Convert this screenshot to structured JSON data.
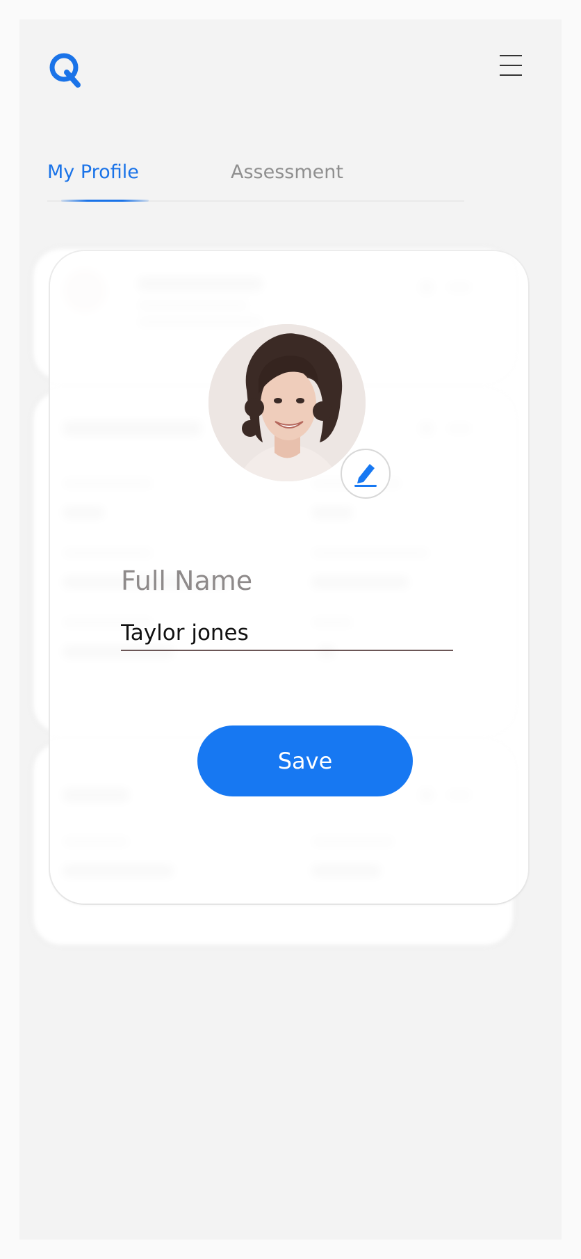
{
  "app": {
    "logo_letter": "Q",
    "brand_color": "#1a73e8"
  },
  "header": {
    "menu_icon": "hamburger-menu-icon"
  },
  "tabs": [
    {
      "label": "My Profile",
      "active": true
    },
    {
      "label": "Assessment",
      "active": false
    }
  ],
  "modal": {
    "field_label": "Full Name",
    "field_value": "Taylor jones",
    "save_label": "Save",
    "edit_icon": "pencil-icon",
    "avatar": "profile-photo"
  },
  "colors": {
    "accent": "#1778f2",
    "tab_inactive": "#8f8f8f"
  }
}
